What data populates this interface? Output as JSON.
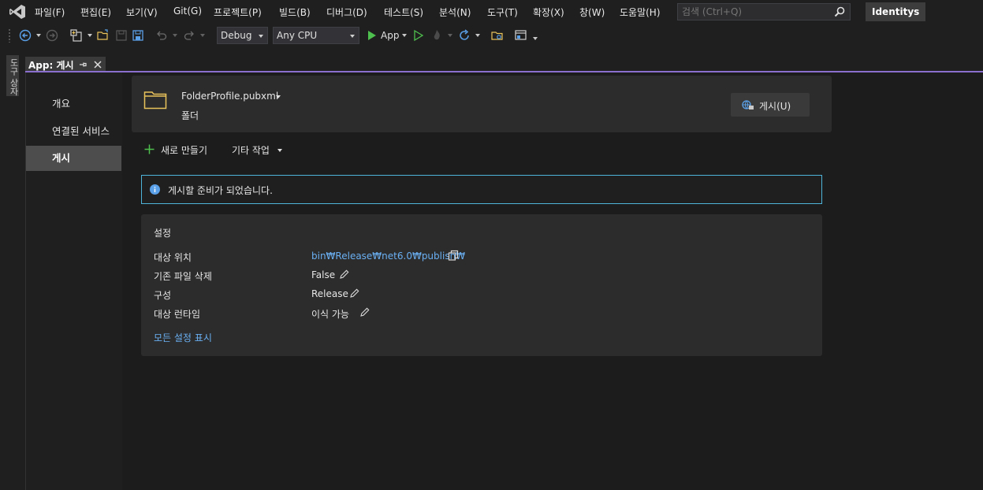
{
  "menubar": {
    "items": [
      "파일(F)",
      "편집(E)",
      "보기(V)",
      "Git(G)",
      "프로젝트(P)",
      "빌드(B)",
      "디버그(D)",
      "테스트(S)",
      "분석(N)",
      "도구(T)",
      "확장(X)",
      "창(W)",
      "도움말(H)"
    ],
    "search_placeholder": "검색 (Ctrl+Q)",
    "solution_name": "Identitys"
  },
  "toolbar": {
    "configuration": "Debug",
    "platform": "Any CPU",
    "run_target": "App"
  },
  "side_tab": {
    "label": "도구 상자"
  },
  "document_tab": {
    "title": "App: 게시"
  },
  "nav": {
    "items": [
      "개요",
      "연결된 서비스",
      "게시"
    ],
    "selected": "게시"
  },
  "profile": {
    "name": "FolderProfile.pubxml",
    "type": "폴더",
    "publish_label": "게시(U)"
  },
  "actions": {
    "new_label": "새로 만들기",
    "more_label": "기타 작업"
  },
  "info": {
    "text": "게시할 준비가 되었습니다."
  },
  "settings": {
    "title": "설정",
    "rows": [
      {
        "label": "대상 위치",
        "value": "bin₩Release₩net6.0₩publish₩"
      },
      {
        "label": "기존 파일 삭제",
        "value": "False"
      },
      {
        "label": "구성",
        "value": "Release"
      },
      {
        "label": "대상 런타임",
        "value": "이식 가능"
      }
    ],
    "show_all_label": "모든 설정 표시"
  },
  "colors": {
    "accent_tab_line": "#8a6fce",
    "link": "#6ab0f3",
    "info_border": "#4fb4d9",
    "run_green": "#4ec04e"
  }
}
